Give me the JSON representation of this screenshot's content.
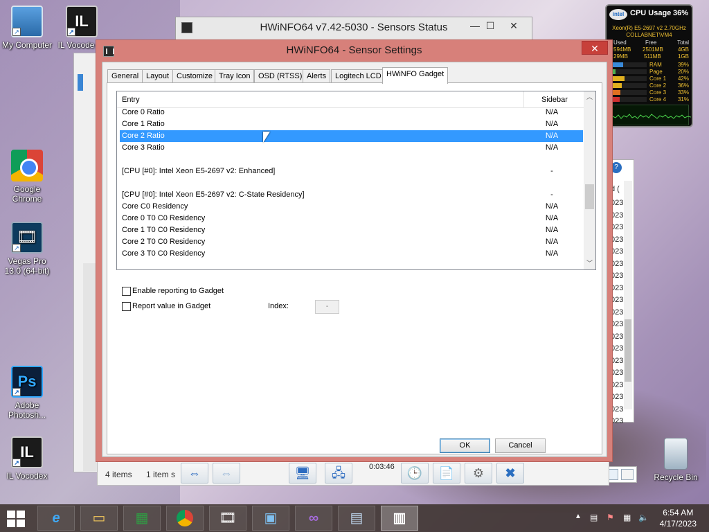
{
  "desktop": {
    "icons": [
      {
        "label": "My Computer"
      },
      {
        "label": "IL Vocode (C"
      },
      {
        "label": "Google Chrome"
      },
      {
        "label": "Vegas Pro 13.0 (64-bit)"
      },
      {
        "label": "Adobe Photosh..."
      },
      {
        "label": "IL Vocodex"
      },
      {
        "label": "Recycle Bin"
      }
    ]
  },
  "back_window": {
    "title": "HWiNFO64 v7.42-5030 - Sensors Status",
    "minimize": "—",
    "maximize": "☐",
    "close": "✕"
  },
  "explorer_status": {
    "items": "4 items",
    "selected": "1 item s",
    "time": "0:03:46"
  },
  "right_window": {
    "col_label": "d (",
    "rows": [
      "023",
      "023",
      "023",
      "023",
      "023",
      "023",
      "023",
      "023",
      "023",
      "023",
      "023",
      "023",
      "023",
      "023",
      "023",
      "023",
      "023",
      "023",
      "023"
    ]
  },
  "gadget": {
    "logo": "intel",
    "title": "CPU Usage",
    "percent": "36%",
    "cpu_line1": "Xeon(R) E5-2697 v2 2.70GHz",
    "cpu_line2": "COLLABNET\\VM4",
    "headers": [
      "Used",
      "Free",
      "Total"
    ],
    "row1": [
      "594MB",
      "2501MB",
      "4GB"
    ],
    "row2": [
      "29MB",
      "511MB",
      "1GB"
    ],
    "bars": [
      {
        "label": "RAM",
        "pct": "39%",
        "fill": 0.39,
        "color": "#3a8ad8"
      },
      {
        "label": "Page",
        "pct": "20%",
        "fill": 0.2,
        "color": "#4caf50"
      },
      {
        "label": "Core 1",
        "pct": "42%",
        "fill": 0.42,
        "color": "#e0b020"
      },
      {
        "label": "Core 2",
        "pct": "36%",
        "fill": 0.36,
        "color": "#e0b020"
      },
      {
        "label": "Core 3",
        "pct": "33%",
        "fill": 0.33,
        "color": "#e07020"
      },
      {
        "label": "Core 4",
        "pct": "31%",
        "fill": 0.31,
        "color": "#d03030"
      }
    ]
  },
  "dialog": {
    "title": "HWiNFO64 - Sensor Settings",
    "close": "✕",
    "tabs": [
      "General",
      "Layout",
      "Customize",
      "Tray Icon",
      "OSD (RTSS)",
      "Alerts",
      "Logitech LCD",
      "HWiNFO Gadget"
    ],
    "active_tab": "HWiNFO Gadget",
    "list": {
      "col_entry": "Entry",
      "col_sidebar": "Sidebar",
      "rows": [
        {
          "entry": "Core 0 Ratio",
          "sidebar": "N/A",
          "selected": false
        },
        {
          "entry": "Core 1 Ratio",
          "sidebar": "N/A",
          "selected": false
        },
        {
          "entry": "Core 2 Ratio",
          "sidebar": "N/A",
          "selected": true
        },
        {
          "entry": "Core 3 Ratio",
          "sidebar": "N/A",
          "selected": false
        },
        {
          "entry": "",
          "sidebar": "",
          "selected": false
        },
        {
          "entry": "[CPU [#0]: Intel Xeon E5-2697 v2: Enhanced]",
          "sidebar": "-",
          "selected": false
        },
        {
          "entry": "",
          "sidebar": "",
          "selected": false
        },
        {
          "entry": "[CPU [#0]: Intel Xeon E5-2697 v2: C-State Residency]",
          "sidebar": "-",
          "selected": false
        },
        {
          "entry": "Core C0 Residency",
          "sidebar": "N/A",
          "selected": false
        },
        {
          "entry": "Core 0 T0 C0 Residency",
          "sidebar": "N/A",
          "selected": false
        },
        {
          "entry": "Core 1 T0 C0 Residency",
          "sidebar": "N/A",
          "selected": false
        },
        {
          "entry": "Core 2 T0 C0 Residency",
          "sidebar": "N/A",
          "selected": false
        },
        {
          "entry": "Core 3 T0 C0 Residency",
          "sidebar": "N/A",
          "selected": false
        }
      ]
    },
    "enable_reporting": "Enable reporting to Gadget",
    "report_value": "Report value in Gadget",
    "index_label": "Index:",
    "index_value": "-",
    "ok": "OK",
    "cancel": "Cancel"
  },
  "taskbar": {
    "clock_time": "6:54 AM",
    "clock_date": "4/17/2023"
  }
}
